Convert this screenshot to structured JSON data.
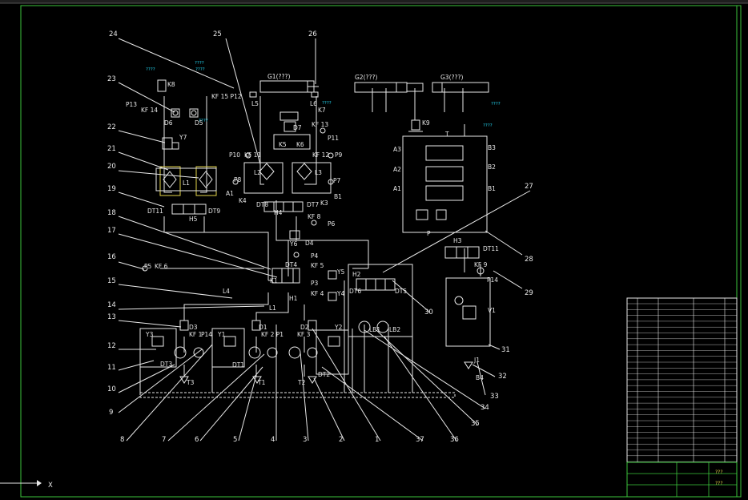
{
  "colors": {
    "background": "#000000",
    "lines": "#e8e8e8",
    "annotation": "#22d3ee",
    "highlight": "#e2d34a",
    "frame": "#3cc43c"
  },
  "callouts": [
    "24",
    "25",
    "26",
    "23",
    "22",
    "21",
    "20",
    "19",
    "18",
    "17",
    "16",
    "15",
    "14",
    "13",
    "12",
    "11",
    "10",
    "9",
    "8",
    "7",
    "6",
    "5",
    "4",
    "3",
    "2",
    "1",
    "37",
    "36",
    "35",
    "34",
    "33",
    "32",
    "31",
    "30",
    "29",
    "28",
    "27"
  ],
  "cylinders": {
    "g1": "G1(???)",
    "g2": "G2(???)",
    "g3": "G3(???)"
  },
  "components": {
    "k8": "K8",
    "kf14": "KF 14",
    "p13": "P13",
    "kf15p12": "KF 15  P12",
    "d6": "D6",
    "d5": "D5",
    "y7": "Y7",
    "l1": "L1",
    "dt11a": "DT11",
    "h5": "H5",
    "dt9": "DT9",
    "l5": "L5",
    "l6": "L6",
    "k7": "K7",
    "kf13": "KF 13",
    "p11": "P11",
    "d7": "D7",
    "k5": "K5",
    "k6": "K6",
    "p10": "P10",
    "kf11": "KF 11",
    "kf12": "KF 12",
    "p9": "P9",
    "p8": "P8",
    "a1": "A1",
    "l2": "L2",
    "l3": "L3",
    "p7": "P7",
    "b1": "B1",
    "k4": "K4",
    "k3": "K3",
    "dt8": "DT8",
    "h4": "H4",
    "dt7": "DT7",
    "kf8": "KF 8",
    "p6": "P6",
    "y6": "Y6",
    "d4": "D4",
    "p4": "P4",
    "dt4": "DT4",
    "k1": "K1",
    "h1": "H1",
    "kf5": "KF 5",
    "p3": "P3",
    "kf4": "KF 4",
    "y5": "Y5",
    "y4": "Y4",
    "h2": "H2",
    "dt6": "DT6",
    "dt5": "DT5",
    "lb1": "LB1",
    "lb2": "LB2",
    "p5": "P5",
    "kf6": "KF 6",
    "l4": "L4",
    "l1b": "L1",
    "d3": "D3",
    "d1": "D1",
    "d2": "D2",
    "y3": "Y3",
    "y1": "Y1",
    "y2": "Y2",
    "kf1": "KF 1",
    "p14a": "P14",
    "kf2p1": "KF 2 P1",
    "kf3": "KF 3",
    "dt3": "DT3",
    "dt1": "DT1",
    "dt2": "DT2",
    "t3": "T3",
    "t1": "T1",
    "t2": "T2",
    "k9": "K9",
    "a3": "A3",
    "a2": "A2",
    "a1v": "A1",
    "b3": "B3",
    "b2": "B2",
    "b1v": "B1",
    "t": "T",
    "p": "P",
    "h3": "H3",
    "dt11b": "DT11",
    "kf9": "KF 9",
    "p14b": "P14",
    "v1": "V1",
    "j1": "J1",
    "b4": "B4"
  },
  "annotations": [
    "????",
    "????",
    "????",
    "????",
    "????",
    "????",
    "????"
  ],
  "coord_label": "X",
  "title_block": {
    "name": "???",
    "drawing": "???"
  }
}
